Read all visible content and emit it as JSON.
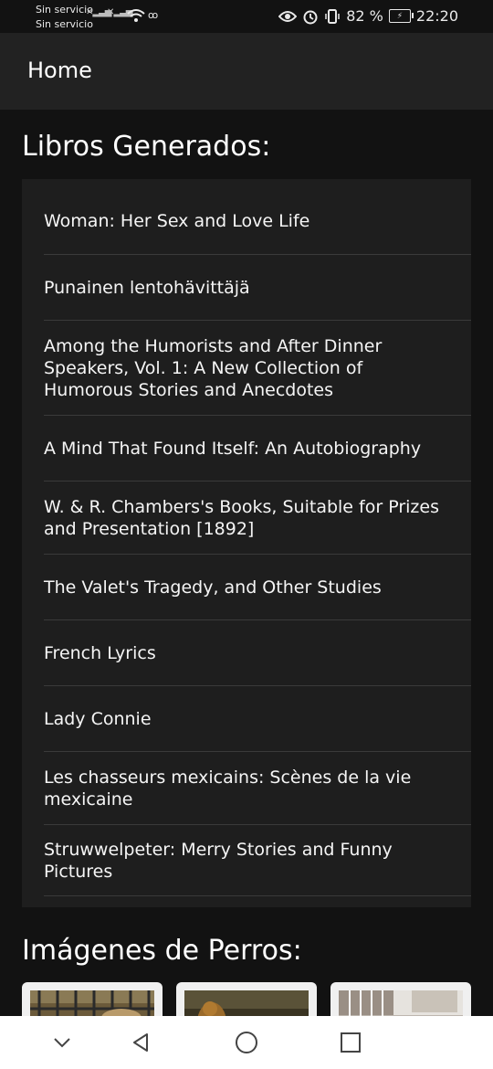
{
  "status_bar": {
    "carrier_1": "Sin servicio",
    "carrier_2": "Sin servicio",
    "battery": "82 %",
    "time": "22:20"
  },
  "app_bar": {
    "title": "Home"
  },
  "books": {
    "heading": "Libros Generados:",
    "items": [
      "Woman: Her Sex and Love Life",
      "Punainen lentohävittäjä",
      "Among the Humorists and After Dinner Speakers, Vol. 1: A New Collection of Humorous Stories and Anecdotes",
      "A Mind That Found Itself: An Autobiography",
      "W. & R. Chambers's Books, Suitable for Prizes and Presentation [1892]",
      "The Valet's Tragedy, and Other Studies",
      "French Lyrics",
      "Lady Connie",
      "Les chasseurs mexicains: Scènes de la vie mexicaine",
      "Struwwelpeter: Merry Stories and Funny Pictures"
    ]
  },
  "dogs": {
    "heading": "Imágenes de Perros:"
  },
  "colors": {
    "background": "#121212",
    "app_bar": "#222222",
    "card": "#1e1e1e",
    "divider": "#3a3a3a"
  },
  "icons": [
    "eye-icon",
    "alarm-icon",
    "vibrate-icon",
    "battery-icon",
    "wifi-icon",
    "back-icon",
    "home-icon",
    "recents-icon",
    "chevron-down-icon"
  ]
}
